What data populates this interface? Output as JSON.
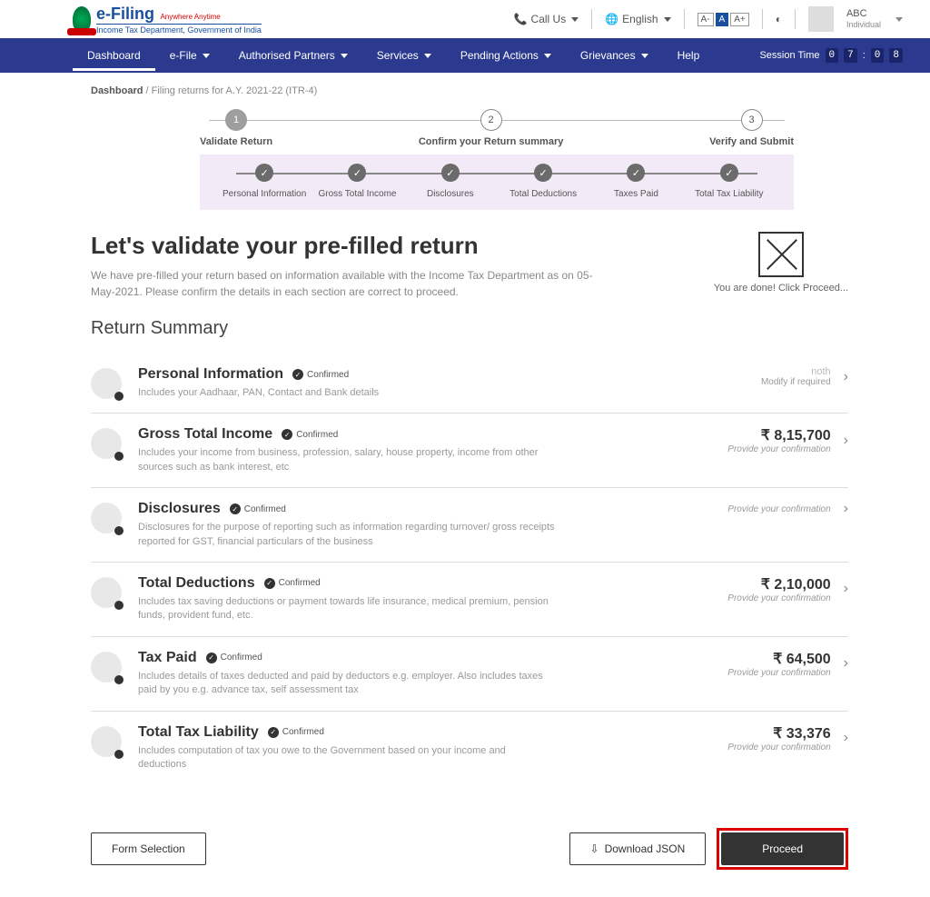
{
  "brand": {
    "title": "e-Filing",
    "tagline": "Anywhere Anytime",
    "dept": "Income Tax Department, Government of India"
  },
  "topbar": {
    "call": "Call Us",
    "lang": "English",
    "font_small": "A-",
    "font_mid": "A",
    "font_large": "A+",
    "user_name": "ABC",
    "user_type": "Individual"
  },
  "nav": {
    "dashboard": "Dashboard",
    "efile": "e-File",
    "partners": "Authorised Partners",
    "services": "Services",
    "pending": "Pending Actions",
    "grievances": "Grievances",
    "help": "Help",
    "session_label": "Session Time",
    "session_m1": "0",
    "session_m2": "7",
    "session_s1": "0",
    "session_s2": "8"
  },
  "breadcrumb": {
    "root": "Dashboard",
    "current": "Filing returns for A.Y. 2021-22 (ITR-4)"
  },
  "steps": {
    "s1": "Validate Return",
    "s2": "Confirm your Return summary",
    "s3": "Verify and Submit",
    "n1": "1",
    "n2": "2",
    "n3": "3"
  },
  "substeps": {
    "a": "Personal Information",
    "b": "Gross Total Income",
    "c": "Disclosures",
    "d": "Total Deductions",
    "e": "Taxes Paid",
    "f": "Total Tax Liability"
  },
  "headline": "Let's validate your pre-filled return",
  "subtext": "We have pre-filled your return based on information available with the Income Tax Department as on 05-May-2021. Please confirm the details in each section are correct to proceed.",
  "done_text": "You are done! Click Proceed...",
  "summary_title": "Return Summary",
  "confirmed": "Confirmed",
  "cards": {
    "c1": {
      "title": "Personal Information",
      "desc": "Includes your Aadhaar, PAN, Contact and Bank details",
      "right_top": "noth",
      "right_sub": "Modify if required"
    },
    "c2": {
      "title": "Gross Total Income",
      "desc": "Includes your income from business, profession,  salary, house property, income from other sources such as bank interest, etc",
      "amount": "₹ 8,15,700",
      "hint": "Provide your confirmation"
    },
    "c3": {
      "title": "Disclosures",
      "desc": "Disclosures for the purpose of reporting such as information regarding turnover/ gross receipts reported for GST, financial particulars of the business",
      "hint": "Provide your confirmation"
    },
    "c4": {
      "title": "Total Deductions",
      "desc": "Includes tax saving deductions or payment towards life insurance, medical premium, pension funds, provident fund, etc.",
      "amount": "₹ 2,10,000",
      "hint": "Provide your confirmation"
    },
    "c5": {
      "title": "Tax Paid",
      "desc": "Includes details of taxes deducted and paid by deductors e.g. employer. Also includes taxes paid by you e.g. advance tax, self assessment tax",
      "amount": "₹ 64,500",
      "hint": "Provide your confirmation"
    },
    "c6": {
      "title": "Total Tax Liability",
      "desc": "Includes computation of tax you owe to the Government based on your income and deductions",
      "amount": "₹ 33,376",
      "hint": "Provide your confirmation"
    }
  },
  "footer": {
    "form_sel": "Form Selection",
    "download": "Download JSON",
    "proceed": "Proceed"
  }
}
